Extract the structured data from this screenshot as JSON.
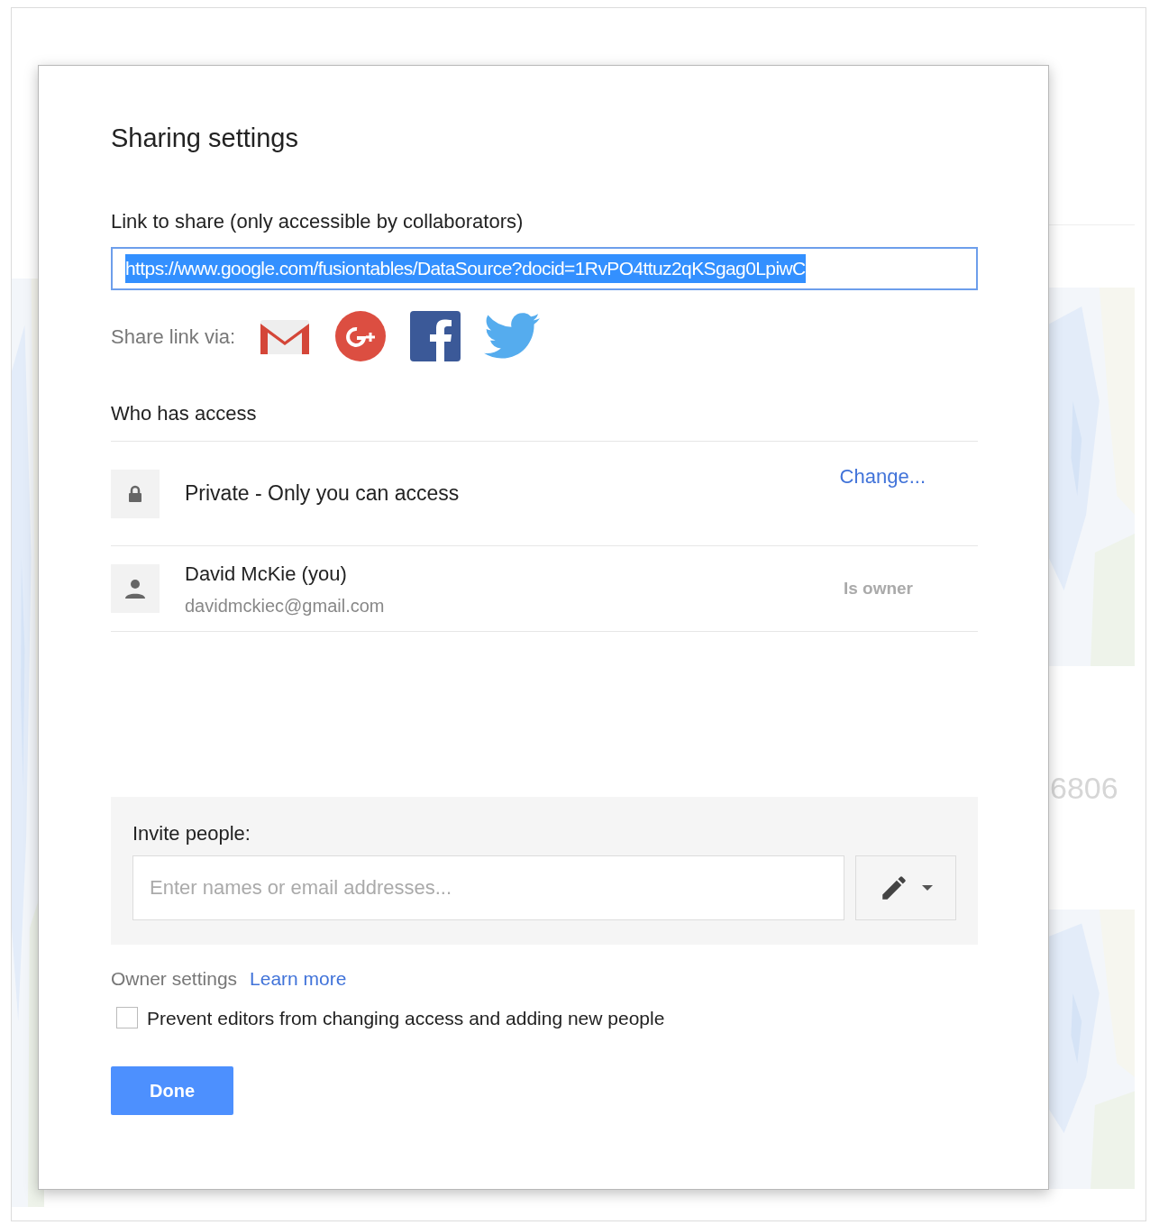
{
  "background": {
    "number_text": "6806"
  },
  "dialog": {
    "title": "Sharing settings",
    "link_label": "Link to share (only accessible by collaborators)",
    "link_value": "https://www.google.com/fusiontables/DataSource?docid=1RvPO4ttuz2qKSgag0LpiwC",
    "link_selected": true,
    "share_label": "Share link via:",
    "share_services": [
      {
        "kind": "gmail"
      },
      {
        "kind": "googleplus"
      },
      {
        "kind": "facebook"
      },
      {
        "kind": "twitter"
      }
    ],
    "access_heading": "Who has access",
    "access_rows": [
      {
        "kind": "visibility",
        "title": "Private - Only you can access",
        "action": "Change..."
      },
      {
        "kind": "person",
        "title": "David McKie (you)",
        "email": "davidmckiec@gmail.com",
        "role": "Is owner"
      }
    ],
    "invite": {
      "label": "Invite people:",
      "placeholder": "Enter names or email addresses..."
    },
    "owner_settings": {
      "label": "Owner settings",
      "link": "Learn more",
      "option": {
        "label": "Prevent editors from changing access and adding new people",
        "checked": false
      }
    },
    "done_button": "Done"
  }
}
